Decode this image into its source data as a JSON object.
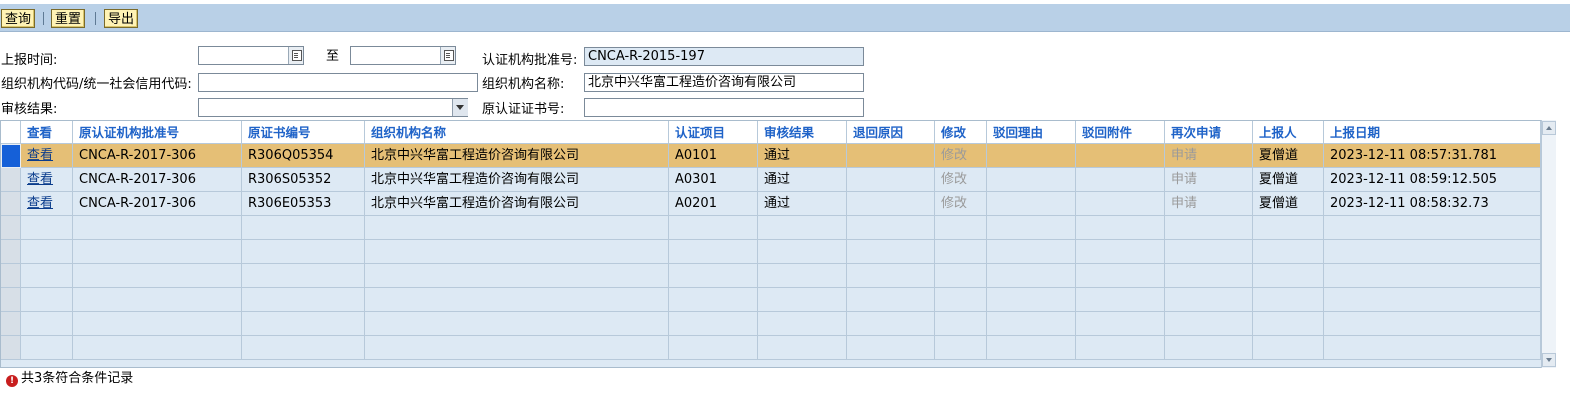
{
  "toolbar": {
    "buttons": [
      {
        "label": "查询"
      },
      {
        "label": "重置"
      },
      {
        "label": "导出"
      }
    ]
  },
  "form": {
    "report_time_label": "上报时间:",
    "report_time_from": "",
    "report_time_to": "",
    "to_label": "至",
    "cert_approval_label": "认证机构批准号:",
    "cert_approval_value": "CNCA-R-2015-197",
    "org_code_label": "组织机构代码/统一社会信用代码:",
    "org_code_value": "",
    "org_name_label": "组织机构名称:",
    "org_name_value": "北京中兴华富工程造价咨询有限公司",
    "review_result_label": "审核结果:",
    "review_result_value": "",
    "original_cert_label": "原认证证书号:",
    "original_cert_value": ""
  },
  "table": {
    "columns": [
      "查看",
      "原认证机构批准号",
      "原证书编号",
      "组织机构名称",
      "认证项目",
      "审核结果",
      "退回原因",
      "修改",
      "驳回理由",
      "驳回附件",
      "再次申请",
      "上报人",
      "上报日期"
    ],
    "rows": [
      {
        "view": "查看",
        "orig_approval": "CNCA-R-2017-306",
        "orig_cert": "R306Q05354",
        "org_name": "北京中兴华富工程造价咨询有限公司",
        "project": "A0101",
        "result": "通过",
        "return_reason": "",
        "modify": "修改",
        "reject_reason": "",
        "reject_attach": "",
        "reapply": "申请",
        "reporter": "夏僧道",
        "date": "2023-12-11 08:57:31.781",
        "selected": true
      },
      {
        "view": "查看",
        "orig_approval": "CNCA-R-2017-306",
        "orig_cert": "R306S05352",
        "org_name": "北京中兴华富工程造价咨询有限公司",
        "project": "A0301",
        "result": "通过",
        "return_reason": "",
        "modify": "修改",
        "reject_reason": "",
        "reject_attach": "",
        "reapply": "申请",
        "reporter": "夏僧道",
        "date": "2023-12-11 08:59:12.505",
        "selected": false
      },
      {
        "view": "查看",
        "orig_approval": "CNCA-R-2017-306",
        "orig_cert": "R306E05353",
        "org_name": "北京中兴华富工程造价咨询有限公司",
        "project": "A0201",
        "result": "通过",
        "return_reason": "",
        "modify": "修改",
        "reject_reason": "",
        "reject_attach": "",
        "reapply": "申请",
        "reporter": "夏僧道",
        "date": "2023-12-11 08:58:32.73",
        "selected": false
      }
    ],
    "empty_rows": 6
  },
  "status": {
    "icon": "error-icon",
    "text": "共3条符合条件记录"
  },
  "colors": {
    "toolbar_bg": "#b9d0e7",
    "header_text": "#1f63c8",
    "selected_row": "#e5bf76",
    "grid_bg": "#dde9f4",
    "row_indicator": "#1560d8"
  }
}
